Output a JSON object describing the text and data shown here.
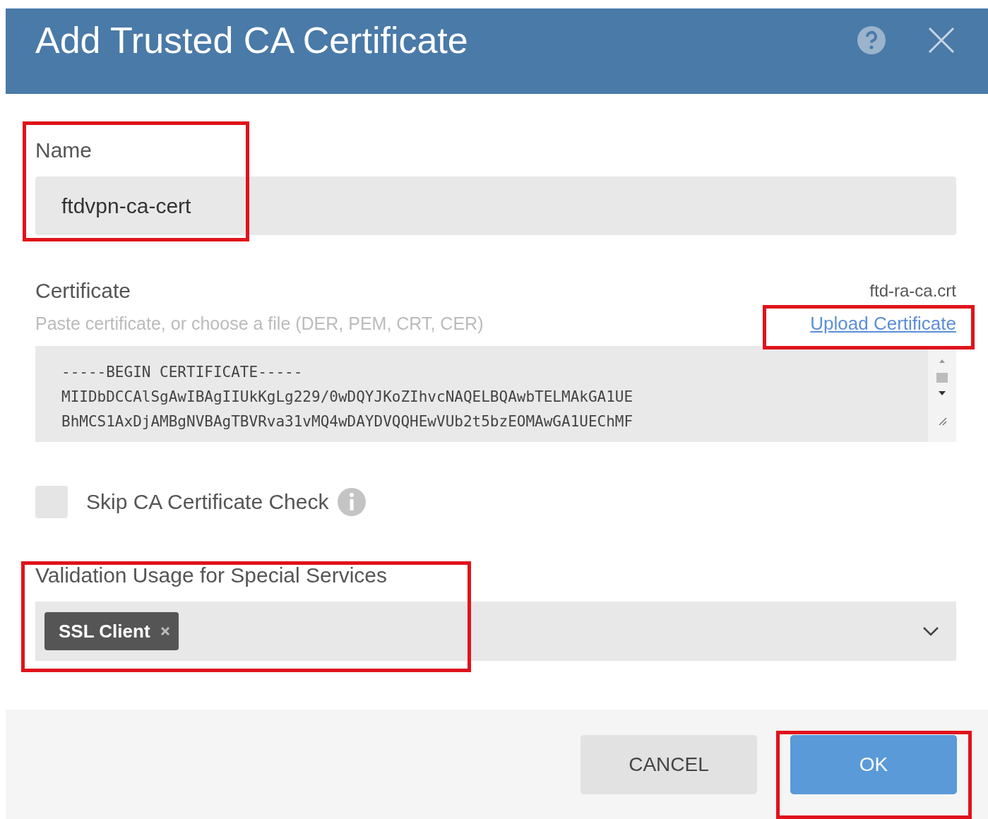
{
  "dialog": {
    "title": "Add Trusted CA Certificate"
  },
  "name_field": {
    "label": "Name",
    "value": "ftdvpn-ca-cert",
    "highlighted": true
  },
  "certificate": {
    "label": "Certificate",
    "file_name": "ftd-ra-ca.crt",
    "hint": "Paste certificate, or choose a file (DER, PEM, CRT, CER)",
    "upload_link": "Upload Certificate",
    "upload_highlighted": true,
    "lines": [
      "-----BEGIN CERTIFICATE-----",
      "MIIDbDCCAlSgAwIBAgIIUkKgLg229/0wDQYJKoZIhvcNAQELBQAwbTELMAkGA1UE",
      "BhMCS1AxDjAMBgNVBAgTBVRva31vMQ4wDAYDVQQHEwVUb2t5bzEOMAwGA1UEChMF"
    ]
  },
  "skip_check": {
    "label": "Skip CA Certificate Check",
    "checked": false
  },
  "validation": {
    "label": "Validation Usage for Special Services",
    "highlighted": true,
    "tags": [
      "SSL Client"
    ]
  },
  "buttons": [
    {
      "label": "CANCEL",
      "kind": "secondary",
      "highlighted": false
    },
    {
      "label": "OK",
      "kind": "primary",
      "highlighted": true
    }
  ]
}
